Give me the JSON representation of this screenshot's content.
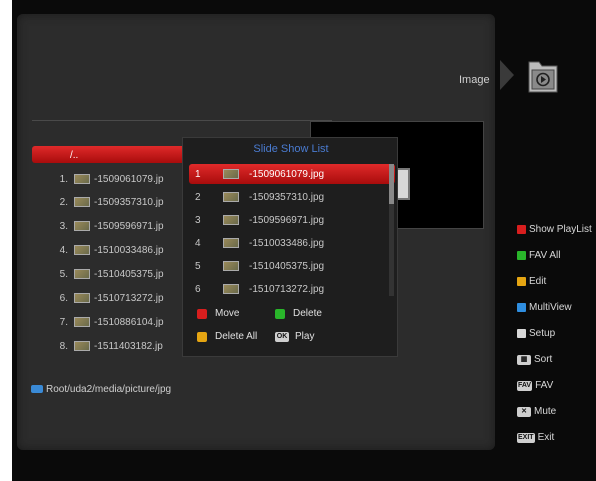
{
  "header": {
    "image_label": "Image"
  },
  "browser": {
    "root_label": "/..",
    "files": [
      {
        "num": "1.",
        "name": "-1509061079.jp"
      },
      {
        "num": "2.",
        "name": "-1509357310.jp"
      },
      {
        "num": "3.",
        "name": "-1509596971.jp"
      },
      {
        "num": "4.",
        "name": "-1510033486.jp"
      },
      {
        "num": "5.",
        "name": "-1510405375.jp"
      },
      {
        "num": "6.",
        "name": "-1510713272.jp"
      },
      {
        "num": "7.",
        "name": "-1510886104.jp"
      },
      {
        "num": "8.",
        "name": "-1511403182.jp"
      }
    ],
    "path": "Root/uda2/media/picture/jpg"
  },
  "playlist": {
    "title": "Slide Show List",
    "items": [
      {
        "num": "1",
        "name": "-1509061079.jpg"
      },
      {
        "num": "2",
        "name": "-1509357310.jpg"
      },
      {
        "num": "3",
        "name": "-1509596971.jpg"
      },
      {
        "num": "4",
        "name": "-1510033486.jpg"
      },
      {
        "num": "5",
        "name": "-1510405375.jpg"
      },
      {
        "num": "6",
        "name": "-1510713272.jpg"
      }
    ],
    "legend": {
      "move": "Move",
      "delete": "Delete",
      "delete_all": "Delete All",
      "play": "Play",
      "ok_key": "OK"
    }
  },
  "side_menu": {
    "show_playlist": "Show PlayList",
    "fav_all": "FAV All",
    "edit": "Edit",
    "multiview": "MultiView",
    "setup": "Setup",
    "sort": "Sort",
    "fav": "FAV",
    "mute": "Mute",
    "exit": "Exit",
    "fav_key": "FAV",
    "exit_key": "EXIT"
  },
  "colors": {
    "red": "#d81e1e",
    "green": "#29b52a",
    "yellow": "#e5a512",
    "blue": "#2f8ee0",
    "white": "#d8d8d8",
    "title_blue": "#4a7bd0"
  }
}
